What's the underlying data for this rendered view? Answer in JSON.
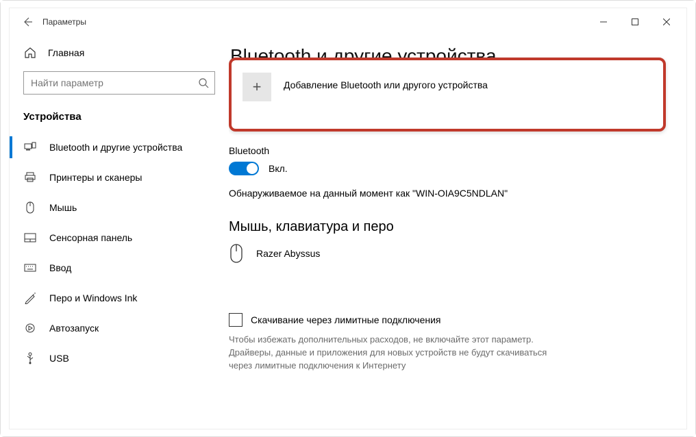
{
  "window": {
    "title": "Параметры"
  },
  "sidebar": {
    "home": "Главная",
    "search_placeholder": "Найти параметр",
    "category": "Устройства",
    "items": [
      {
        "label": "Bluetooth и другие устройства"
      },
      {
        "label": "Принтеры и сканеры"
      },
      {
        "label": "Мышь"
      },
      {
        "label": "Сенсорная панель"
      },
      {
        "label": "Ввод"
      },
      {
        "label": "Перо и Windows Ink"
      },
      {
        "label": "Автозапуск"
      },
      {
        "label": "USB"
      }
    ]
  },
  "main": {
    "page_title": "Bluetooth и другие устройства",
    "add_label": "Добавление Bluetooth или другого устройства",
    "bt_label": "Bluetooth",
    "bt_state": "Вкл.",
    "discoverable": "Обнаруживаемое на данный момент как \"WIN-OIA9C5NDLAN\"",
    "mkp_title": "Мышь, клавиатура и перо",
    "device1": "Razer Abyssus",
    "download_label": "Скачивание через лимитные подключения",
    "help_text": "Чтобы избежать дополнительных расходов, не включайте этот параметр. Драйверы, данные и приложения для новых устройств не будут скачиваться через лимитные подключения к Интернету"
  }
}
